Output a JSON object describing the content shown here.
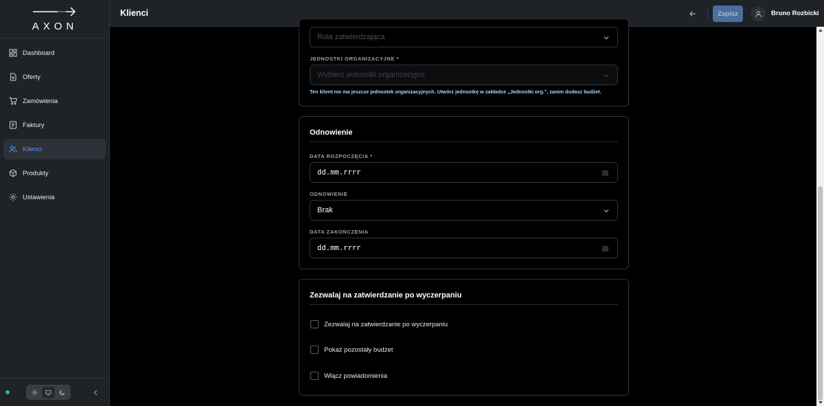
{
  "app": {
    "logo_text": "AXON"
  },
  "sidebar": {
    "items": [
      {
        "label": "Dashboard",
        "icon": "dashboard-icon",
        "active": false
      },
      {
        "label": "Oferty",
        "icon": "document-icon",
        "active": false
      },
      {
        "label": "Zamówienia",
        "icon": "cart-icon",
        "active": false
      },
      {
        "label": "Faktury",
        "icon": "invoice-icon",
        "active": false
      },
      {
        "label": "Klienci",
        "icon": "users-icon",
        "active": true
      },
      {
        "label": "Produkty",
        "icon": "package-icon",
        "active": false
      },
      {
        "label": "Ustawienia",
        "icon": "gear-icon",
        "active": false
      }
    ],
    "footer": {
      "status_color": "#22c55e",
      "theme_options": [
        "sun-icon",
        "monitor-icon",
        "moon-icon"
      ],
      "theme_selected": "monitor-icon"
    }
  },
  "header": {
    "title": "Klienci",
    "save_label": "Zapisz",
    "user_name": "Bruno Rozbicki"
  },
  "org_card": {
    "role_placeholder": "Rola zatwierdzająca",
    "units_label": "JEDNOSTKI ORGANIZACYJNE *",
    "units_placeholder": "Wybierz jednostki organizacyjne",
    "hint": "Ten klient nie ma jeszcze jednostek organizacyjnych. Utwórz jednostkę w zakładce „Jednostki org.\", zanim dodasz budżet."
  },
  "renewal_card": {
    "title": "Odnowienie",
    "start_label": "DATA ROZPOCZĘCIA *",
    "start_value": "dd.mm.rrrr",
    "renewal_label": "ODNOWIENIE",
    "renewal_value": "Brak",
    "end_label": "DATA ZAKOŃCZENIA",
    "end_value": "dd.mm.rrrr"
  },
  "approval_card": {
    "title": "Zezwalaj na zatwierdzanie po wyczerpaniu",
    "checkboxes": [
      {
        "label": "Zezwalaj na zatwierdzanie po wyczerpaniu",
        "checked": false
      },
      {
        "label": "Pokaż pozostały budżet",
        "checked": false
      },
      {
        "label": "Włącz powiadomienia",
        "checked": false
      }
    ]
  },
  "colors": {
    "accent": "#5b9bf0",
    "save_button": "#4a6f9d",
    "hint_text": "#a5d8ff",
    "sidebar_bg": "#1f2227"
  }
}
